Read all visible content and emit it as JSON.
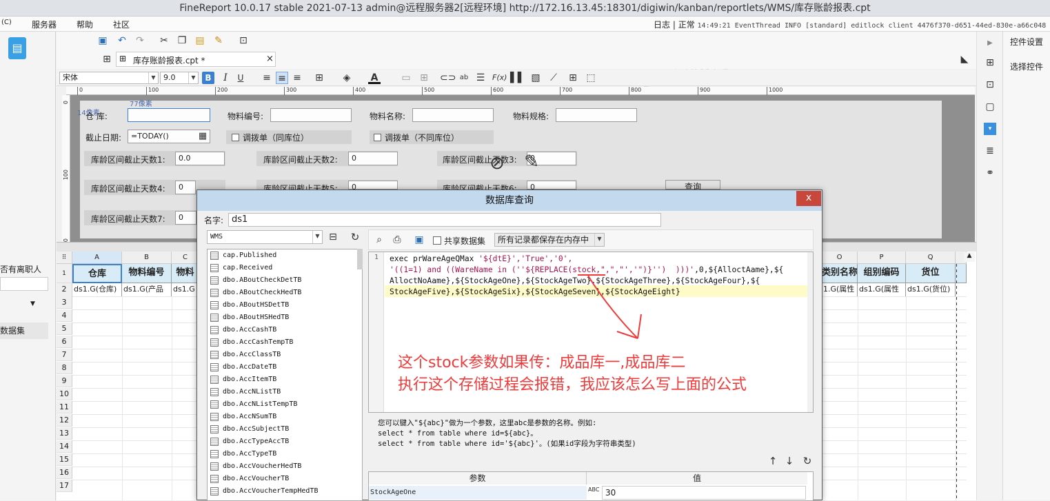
{
  "window": {
    "title": "FineReport 10.0.17 stable 2021-07-13 admin@远程服务器2[远程环境]    http://172.16.13.45:18301/digiwin/kanban/reportlets/WMS/库存账龄报表.cpt"
  },
  "menu": {
    "c": "(C)",
    "server": "服务器",
    "help": "帮助",
    "community": "社区"
  },
  "status": {
    "log": "日志",
    "normal": "正常",
    "detail": "14:49:21 EventThread INFO [standard] editlock client 4476f370-d651-44ed-830e-a66c048"
  },
  "tab": {
    "file": "库存账龄报表.cpt *",
    "close": "×"
  },
  "format": {
    "font": "宋体",
    "size": "9.0"
  },
  "ruler": {
    "ticks": [
      "0",
      "100",
      "200",
      "300",
      "400",
      "500",
      "600",
      "700",
      "800",
      "900",
      "1000"
    ],
    "vticks": [
      "0",
      "100",
      "200"
    ]
  },
  "right_panel": {
    "settings": "控件设置",
    "select": "选择控件"
  },
  "left": {
    "item1": "否有离职人",
    "item2": "数据集"
  },
  "form": {
    "px1": "77像素",
    "px2": "14像素",
    "warehouse": "仓    库:",
    "itemno": "物料编号:",
    "itemname": "物料名称:",
    "itemspec": "物料规格:",
    "cutoff": "截止日期:",
    "cutoff_val": "=TODAY()",
    "chk1": "调拨单（同库位）",
    "chk2": "调拨单（不同库位）",
    "d1": "库龄区间截止天数1:",
    "d1v": "0.0",
    "d2": "库龄区间截止天数2:",
    "d2v": "0",
    "d3": "库龄区间截止天数3:",
    "d3v": "0",
    "d4": "库龄区间截止天数4:",
    "d4v": "0",
    "d5": "库龄区间截止天数5:",
    "d5v": "0",
    "d6": "库龄区间截止天数6:",
    "d6v": "0",
    "d7": "库龄区间截止天数7:",
    "d7v": "0",
    "query": "查询"
  },
  "sheet": {
    "cols": [
      "A",
      "B",
      "C",
      "O",
      "P",
      "Q"
    ],
    "header_row": "1 (H)",
    "rows": [
      "2",
      "3",
      "4",
      "5",
      "6",
      "7",
      "8",
      "9",
      "10",
      "11",
      "12",
      "13",
      "14",
      "15",
      "16",
      "17"
    ],
    "a1": "仓库",
    "b1": "物料编号",
    "c1": "物料",
    "o1": "类别名称",
    "p1": "组别编码",
    "q1": "货位",
    "a2": "ds1.G(仓库)",
    "b2": "ds1.G(产品",
    "c2": "ds1.G",
    "o2": "1.G(属性",
    "p2": "ds1.G(属性",
    "q2": "ds1.G(货位)"
  },
  "dialog": {
    "title": "数据库查询",
    "close": "x",
    "name_label": "名字:",
    "name_value": "ds1",
    "db": "WMS",
    "shared": "共享数据集",
    "memory": "所有记录都保存在内存中",
    "tables": [
      "cap.Published",
      "cap.Received",
      "dbo.ABoutCheckDetTB",
      "dbo.ABoutCheckHedTB",
      "dbo.ABoutHSDetTB",
      "dbo.ABoutHSHedTB",
      "dbo.AccCashTB",
      "dbo.AccCashTempTB",
      "dbo.AccClassTB",
      "dbo.AccDateTB",
      "dbo.AccItemTB",
      "dbo.AccNListTB",
      "dbo.AccNListTempTB",
      "dbo.AccNSumTB",
      "dbo.AccSubjectTB",
      "dbo.AccTypeAccTB",
      "dbo.AccTypeTB",
      "dbo.AccVoucherHedTB",
      "dbo.AccVoucherTB",
      "dbo.AccVoucherTempHedTB"
    ],
    "line_no": "1",
    "sql_l1a": "exec prWareAgeQMax ",
    "sql_l1b": "'${dtE}','True','0',",
    "sql_l2a": "'((1=1) and ((WareName in (''${REPLACE(stock,\",\",\"','\")}'')  )))'",
    "sql_l2b": ",0,${AlloctAame},${",
    "sql_l3": "AlloctNoAame},${StockAgeOne},${StockAgeTwo},${StockAgeThree},${StockAgeFour},${",
    "sql_l4": "StockAgeFive},${StockAgeSix},${StockAgeSeven},${StockAgeEight}",
    "annotation1": "这个stock参数如果传：成品库一,成品库二",
    "annotation2": "执行这个存储过程会报错，我应该怎么写上面的公式",
    "hint": "您可以键入\"${abc}\"做为一个参数，这里abc是参数的名称。例如:\nselect * from table where id=${abc}。\nselect * from table where id='${abc}'。(如果id字段为字符串类型)",
    "param_col": "参数",
    "value_col": "值",
    "param1": "StockAgeOne",
    "value1": "30"
  },
  "colors": {
    "annotation": "#f03a3a",
    "sql_string": "#a8124e",
    "highlight": "#fffbc8",
    "header_cell": "#d8ecf7",
    "dialog_title": "#c3d9ee",
    "close": "#c9463b"
  }
}
